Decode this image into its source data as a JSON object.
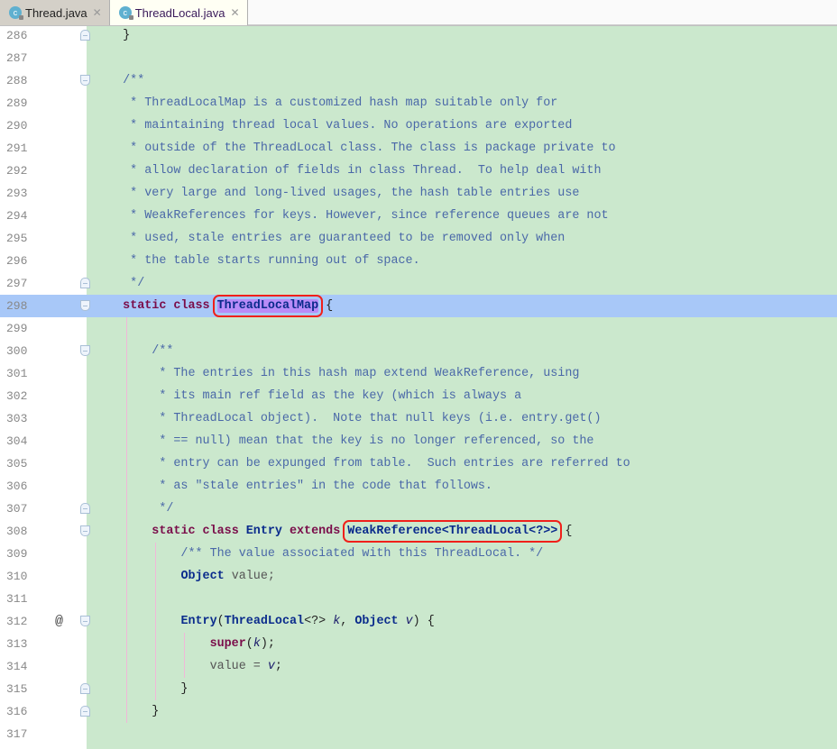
{
  "tabs": [
    {
      "label": "Thread.java",
      "active": false,
      "icon": "java-class-icon"
    },
    {
      "label": "ThreadLocal.java",
      "active": true,
      "icon": "java-class-icon"
    }
  ],
  "colors": {
    "editor_bg": "#cbe8cd",
    "current_line": "#a8c8f8",
    "selection": "#b98cf8",
    "annotation_box": "#f0201a"
  },
  "current_line": 298,
  "lines": [
    {
      "n": 286,
      "fold": "end",
      "tokens": [
        [
          "p",
          "    }"
        ]
      ]
    },
    {
      "n": 287,
      "tokens": []
    },
    {
      "n": 288,
      "fold": "start",
      "tokens": [
        [
          "c",
          "    /**"
        ]
      ]
    },
    {
      "n": 289,
      "tokens": [
        [
          "c",
          "     * ThreadLocalMap is a customized hash map suitable only for"
        ]
      ]
    },
    {
      "n": 290,
      "tokens": [
        [
          "c",
          "     * maintaining thread local values. No operations are exported"
        ]
      ]
    },
    {
      "n": 291,
      "tokens": [
        [
          "c",
          "     * outside of the ThreadLocal class. The class is package private to"
        ]
      ]
    },
    {
      "n": 292,
      "tokens": [
        [
          "c",
          "     * allow declaration of fields in class Thread.  To help deal with"
        ]
      ]
    },
    {
      "n": 293,
      "tokens": [
        [
          "c",
          "     * very large and long-lived usages, the hash table entries use"
        ]
      ]
    },
    {
      "n": 294,
      "tokens": [
        [
          "c",
          "     * WeakReferences for keys. However, since reference queues are not"
        ]
      ]
    },
    {
      "n": 295,
      "tokens": [
        [
          "c",
          "     * used, stale entries are guaranteed to be removed only when"
        ]
      ]
    },
    {
      "n": 296,
      "tokens": [
        [
          "c",
          "     * the table starts running out of space."
        ]
      ]
    },
    {
      "n": 297,
      "fold": "end",
      "tokens": [
        [
          "c",
          "     */"
        ]
      ]
    },
    {
      "n": 298,
      "fold": "start",
      "tokens": [
        [
          "p",
          "    "
        ],
        [
          "k",
          "static class "
        ],
        [
          "t sel box",
          "ThreadLocalMap"
        ],
        [
          "p",
          " {"
        ]
      ]
    },
    {
      "n": 299,
      "tokens": []
    },
    {
      "n": 300,
      "fold": "start",
      "tokens": [
        [
          "c",
          "        /**"
        ]
      ]
    },
    {
      "n": 301,
      "tokens": [
        [
          "c",
          "         * The entries in this hash map extend WeakReference, using"
        ]
      ]
    },
    {
      "n": 302,
      "tokens": [
        [
          "c",
          "         * its main ref field as the key (which is always a"
        ]
      ]
    },
    {
      "n": 303,
      "tokens": [
        [
          "c",
          "         * ThreadLocal object).  Note that null keys (i.e. entry.get()"
        ]
      ]
    },
    {
      "n": 304,
      "tokens": [
        [
          "c",
          "         * == null) mean that the key is no longer referenced, so the"
        ]
      ]
    },
    {
      "n": 305,
      "tokens": [
        [
          "c",
          "         * entry can be expunged from table.  Such entries are referred to"
        ]
      ]
    },
    {
      "n": 306,
      "tokens": [
        [
          "c",
          "         * as \"stale entries\" in the code that follows."
        ]
      ]
    },
    {
      "n": 307,
      "fold": "end",
      "tokens": [
        [
          "c",
          "         */"
        ]
      ]
    },
    {
      "n": 308,
      "fold": "start",
      "tokens": [
        [
          "p",
          "        "
        ],
        [
          "k",
          "static class "
        ],
        [
          "t",
          "Entry "
        ],
        [
          "k",
          "extends "
        ],
        [
          "t box",
          "WeakReference<ThreadLocal<?>>"
        ],
        [
          "p",
          " {"
        ]
      ]
    },
    {
      "n": 309,
      "tokens": [
        [
          "c",
          "            /** The value associated with this ThreadLocal. */"
        ]
      ]
    },
    {
      "n": 310,
      "tokens": [
        [
          "p",
          "            "
        ],
        [
          "t",
          "Object "
        ],
        [
          "v",
          "value;"
        ]
      ]
    },
    {
      "n": 311,
      "tokens": []
    },
    {
      "n": 312,
      "fold": "start",
      "mark": "@",
      "tokens": [
        [
          "p",
          "            "
        ],
        [
          "t",
          "Entry"
        ],
        [
          "p",
          "("
        ],
        [
          "t",
          "ThreadLocal"
        ],
        [
          "p",
          "<?> "
        ],
        [
          "i",
          "k"
        ],
        [
          "p",
          ", "
        ],
        [
          "t",
          "Object "
        ],
        [
          "i",
          "v"
        ],
        [
          "p",
          ") {"
        ]
      ]
    },
    {
      "n": 313,
      "tokens": [
        [
          "p",
          "                "
        ],
        [
          "k",
          "super"
        ],
        [
          "p",
          "("
        ],
        [
          "i",
          "k"
        ],
        [
          "p",
          ");"
        ]
      ]
    },
    {
      "n": 314,
      "tokens": [
        [
          "p",
          "                "
        ],
        [
          "v",
          "value = "
        ],
        [
          "i",
          "v"
        ],
        [
          "p",
          ";"
        ]
      ]
    },
    {
      "n": 315,
      "fold": "end",
      "tokens": [
        [
          "p",
          "            }"
        ]
      ]
    },
    {
      "n": 316,
      "fold": "end",
      "tokens": [
        [
          "p",
          "        }"
        ]
      ]
    },
    {
      "n": 317,
      "tokens": []
    }
  ]
}
